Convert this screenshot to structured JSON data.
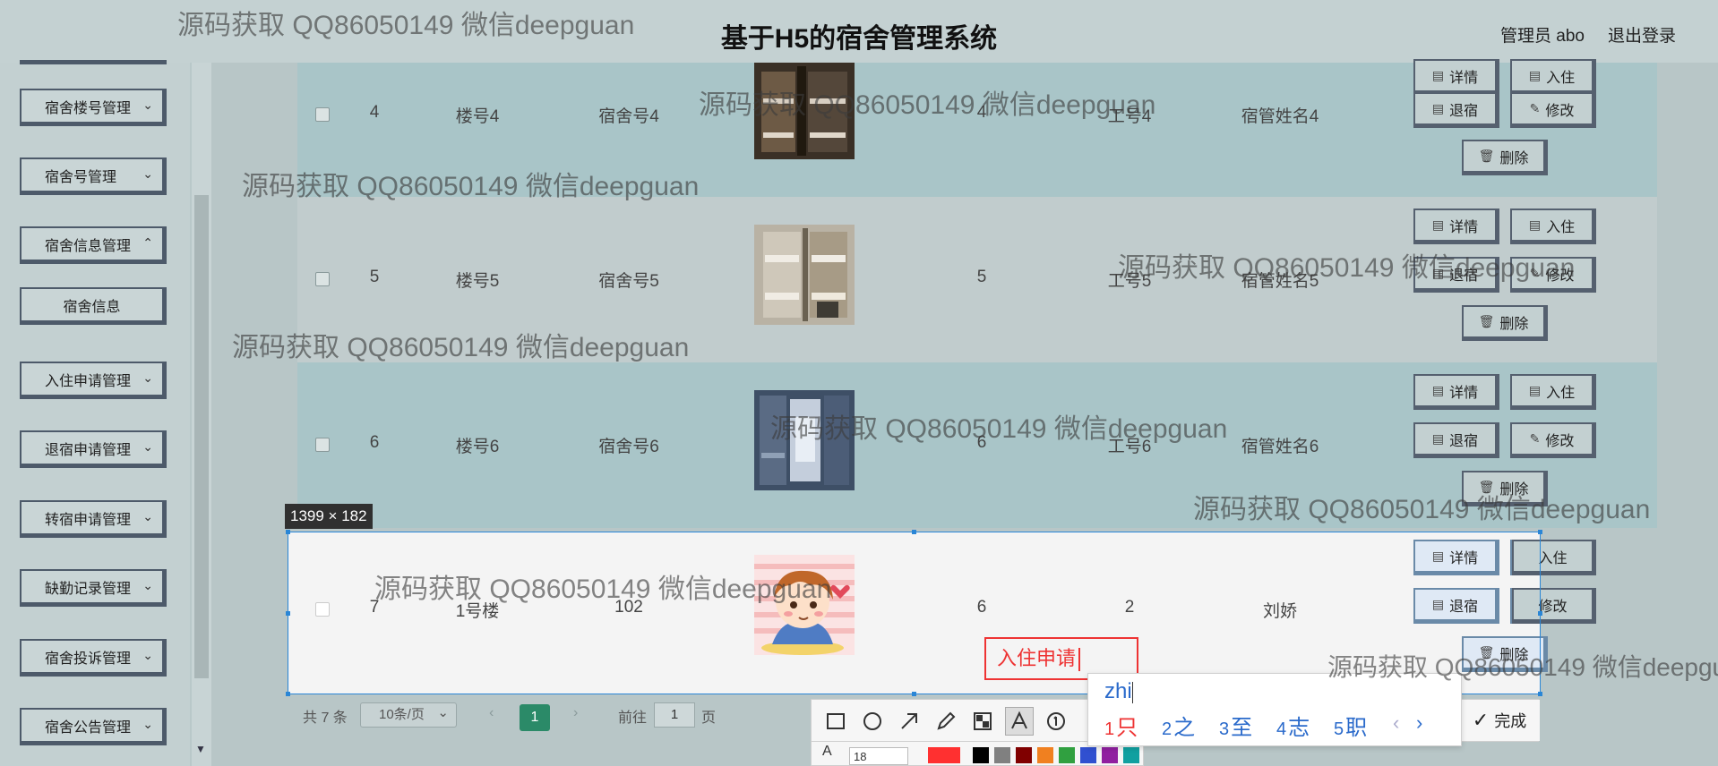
{
  "header": {
    "title": "基于H5的宿舍管理系统",
    "admin": "管理员 abo",
    "logout": "退出登录"
  },
  "sidebar": {
    "items": [
      {
        "label": "宿舍楼号管理",
        "chevron": "chevron-down-icon"
      },
      {
        "label": "宿舍号管理",
        "chevron": "chevron-down-icon"
      },
      {
        "label": "宿舍信息管理",
        "chevron": "chevron-down-icon"
      },
      {
        "label": "宿舍信息"
      },
      {
        "label": "入住申请管理",
        "chevron": "chevron-down-icon"
      },
      {
        "label": "退宿申请管理",
        "chevron": "chevron-down-icon"
      },
      {
        "label": "转宿申请管理",
        "chevron": "chevron-down-icon"
      },
      {
        "label": "缺勤记录管理",
        "chevron": "chevron-down-icon"
      },
      {
        "label": "宿舍投诉管理",
        "chevron": "chevron-down-icon"
      },
      {
        "label": "宿舍公告管理",
        "chevron": "chevron-down-icon"
      }
    ]
  },
  "table": {
    "rows": [
      {
        "index": "4",
        "building": "楼号4",
        "room": "宿舍号4",
        "capacity": "4",
        "staff_id": "工号4",
        "manager": "宿管姓名4"
      },
      {
        "index": "5",
        "building": "楼号5",
        "room": "宿舍号5",
        "capacity": "5",
        "staff_id": "工号5",
        "manager": "宿管姓名5"
      },
      {
        "index": "6",
        "building": "楼号6",
        "room": "宿舍号6",
        "capacity": "6",
        "staff_id": "工号6",
        "manager": "宿管姓名6"
      },
      {
        "index": "7",
        "building": "1号楼",
        "room": "102",
        "capacity": "6",
        "staff_id": "2",
        "manager": "刘娇"
      }
    ],
    "actions": {
      "detail": "详情",
      "checkin": "入住",
      "checkout": "退宿",
      "edit": "修改",
      "delete": "删除"
    }
  },
  "pagination": {
    "total": "共 7 条",
    "page_size": "10条/页",
    "current_page": "1",
    "goto_prefix": "前往",
    "goto_value": "1",
    "goto_suffix": "页"
  },
  "screenshot_tool": {
    "selection_size": "1399 × 182",
    "typed_text": "入住申请",
    "done_label": "完成",
    "font_size": "18",
    "tools": [
      "rectangle-icon",
      "ellipse-icon",
      "arrow-icon",
      "pencil-icon",
      "mosaic-icon",
      "text-icon",
      "number-icon"
    ],
    "colors": [
      "#ff3030",
      "#000000",
      "#808080",
      "#800000",
      "#f08020",
      "#30a040",
      "#3050d0",
      "#9020a0",
      "#10a0a0"
    ]
  },
  "ime": {
    "input": "zhi",
    "candidates": [
      {
        "num": "1",
        "char": "只"
      },
      {
        "num": "2",
        "char": "之"
      },
      {
        "num": "3",
        "char": "至"
      },
      {
        "num": "4",
        "char": "志"
      },
      {
        "num": "5",
        "char": "职"
      }
    ]
  },
  "watermark": {
    "text": "源码获取 QQ86050149 微信deepguan"
  }
}
